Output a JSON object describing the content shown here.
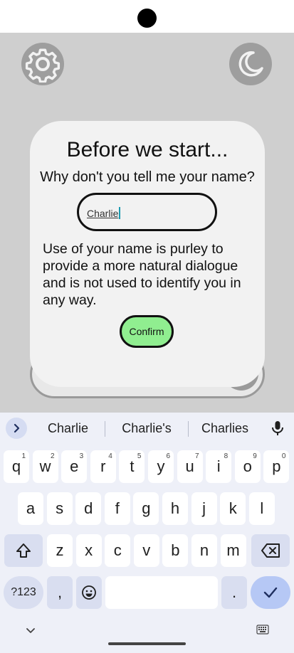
{
  "app": {
    "icons": {
      "settings": "gear-icon",
      "theme": "moon-icon"
    },
    "colors": {
      "background": "#cfcfcf",
      "icon_bg": "#9e9e9e",
      "confirm_bg": "#90ee90"
    }
  },
  "dialog": {
    "title": "Before we start...",
    "question": "Why don't you tell me your name?",
    "name_value": "Charlie",
    "note": "Use of your name is purley to provide a more natural dialogue and is not used to identify you in any way.",
    "confirm_label": "Confirm"
  },
  "keyboard": {
    "suggestions": [
      "Charlie",
      "Charlie's",
      "Charlies"
    ],
    "row1": [
      {
        "k": "q",
        "h": "1"
      },
      {
        "k": "w",
        "h": "2"
      },
      {
        "k": "e",
        "h": "3"
      },
      {
        "k": "r",
        "h": "4"
      },
      {
        "k": "t",
        "h": "5"
      },
      {
        "k": "y",
        "h": "6"
      },
      {
        "k": "u",
        "h": "7"
      },
      {
        "k": "i",
        "h": "8"
      },
      {
        "k": "o",
        "h": "9"
      },
      {
        "k": "p",
        "h": "0"
      }
    ],
    "row2": [
      "a",
      "s",
      "d",
      "f",
      "g",
      "h",
      "j",
      "k",
      "l"
    ],
    "row3": [
      "z",
      "x",
      "c",
      "v",
      "b",
      "n",
      "m"
    ],
    "symbols_label": "?123",
    "comma": ",",
    "period": "."
  }
}
